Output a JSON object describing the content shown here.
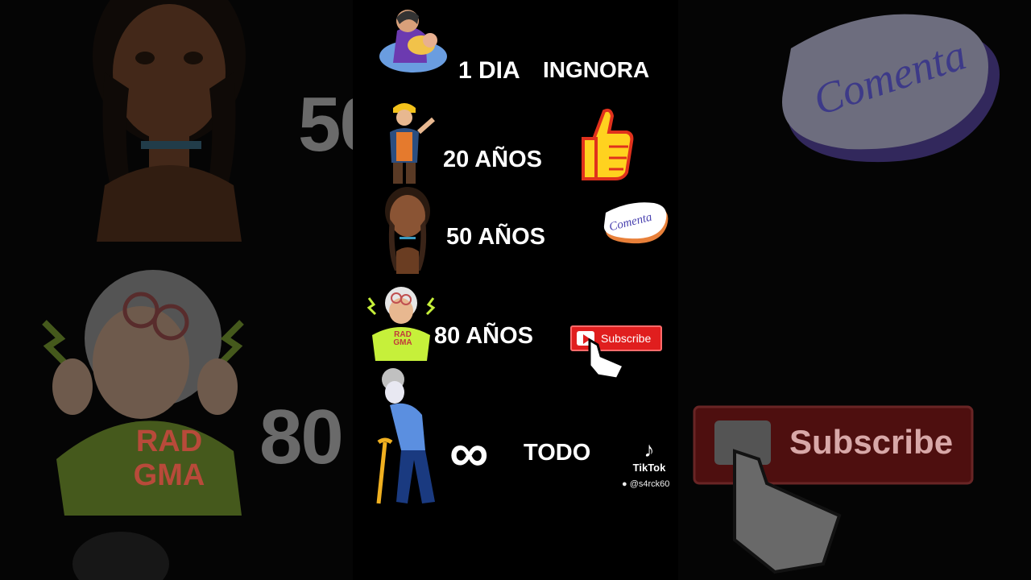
{
  "rows": [
    {
      "age": "1 DIA",
      "reaction": "INGNORA"
    },
    {
      "age": "20 AÑOS",
      "reaction": "thumbs-up"
    },
    {
      "age": "50 AÑOS",
      "reaction": "Comenta"
    },
    {
      "age": "80 AÑOS",
      "reaction": "Subscribe"
    },
    {
      "age": "∞",
      "reaction": "TODO"
    }
  ],
  "stickers": {
    "comenta": "Comenta",
    "subscribe": "Subscribe",
    "radgma_line1": "RAD",
    "radgma_line2": "GMA"
  },
  "background": {
    "num_50": "50",
    "num_80": "80"
  },
  "watermark": {
    "brand": "TikTok",
    "handle": "@s4rck60"
  },
  "colors": {
    "background": "#000000",
    "subscribe_red": "#e01e1e",
    "thumb_yellow": "#ffd21f",
    "radgma_green": "#c6f03a"
  }
}
